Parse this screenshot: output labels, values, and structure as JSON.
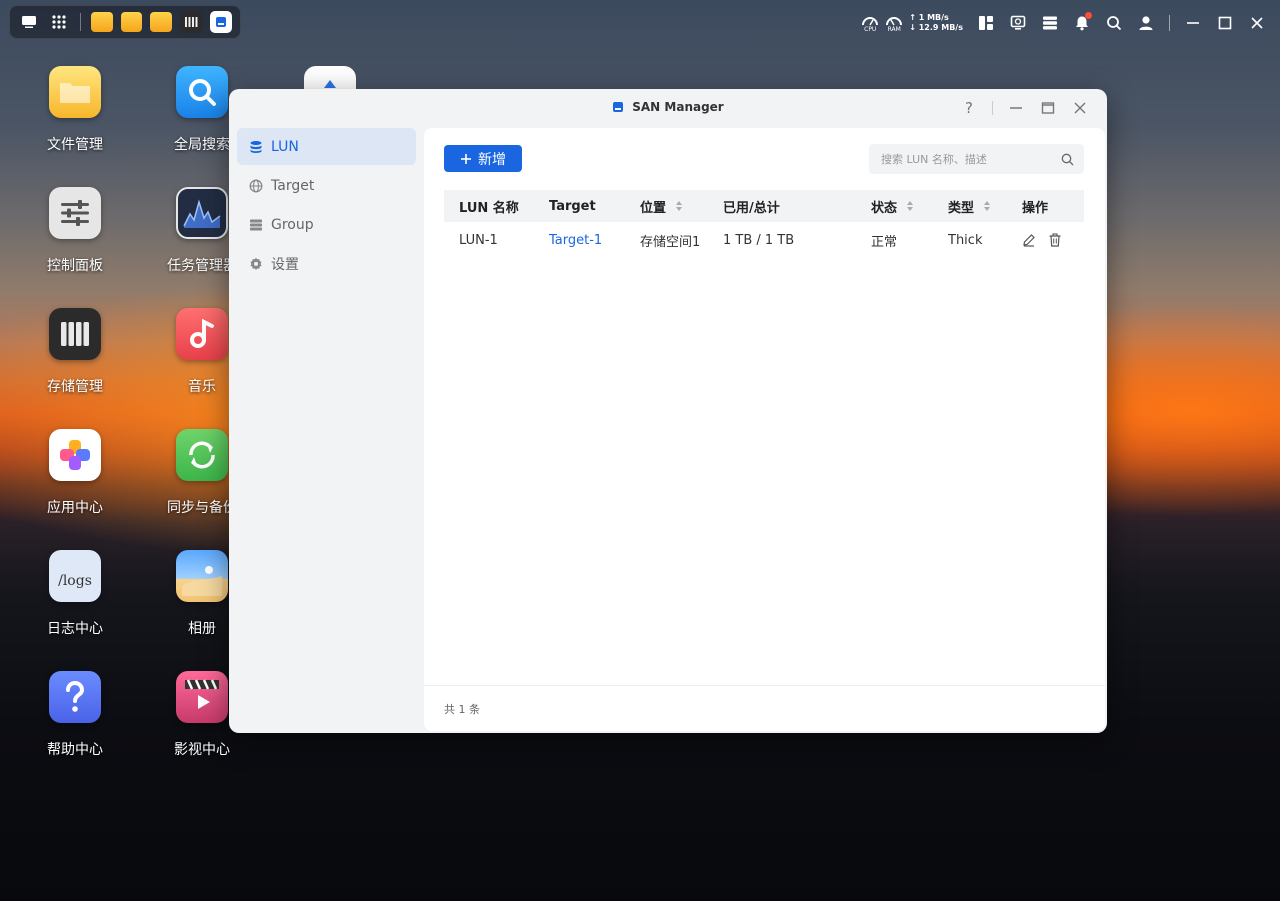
{
  "desktop": {
    "icons": [
      {
        "label": "文件管理"
      },
      {
        "label": "控制面板"
      },
      {
        "label": "存储管理"
      },
      {
        "label": "应用中心"
      },
      {
        "label": "日志中心"
      },
      {
        "label": "帮助中心"
      },
      {
        "label": "全局搜索"
      },
      {
        "label": "任务管理器"
      },
      {
        "label": "音乐"
      },
      {
        "label": "同步与备份"
      },
      {
        "label": "相册"
      },
      {
        "label": "影视中心"
      }
    ],
    "logs_icon_text": "/logs"
  },
  "taskbar": {
    "cpu_label": "CPU",
    "ram_label": "RAM",
    "net_up": "↑ 1 MB/s",
    "net_down": "↓ 12.9 MB/s"
  },
  "window": {
    "title": "SAN Manager",
    "help": "?",
    "sidebar": [
      {
        "label": "LUN"
      },
      {
        "label": "Target"
      },
      {
        "label": "Group"
      },
      {
        "label": "设置"
      }
    ],
    "add_button": "新增",
    "search_placeholder": "搜索 LUN 名称、描述",
    "table": {
      "columns": [
        "LUN 名称",
        "Target",
        "位置",
        "已用/总计",
        "状态",
        "类型",
        "操作"
      ],
      "rows": [
        {
          "name": "LUN-1",
          "target": "Target-1",
          "location": "存储空间1",
          "usage": "1 TB / 1 TB",
          "status": "正常",
          "type": "Thick"
        }
      ]
    },
    "footer": "共 1 条"
  },
  "colors": {
    "accent": "#1a66e0",
    "sidebar_active_bg": "#dce6f5"
  }
}
